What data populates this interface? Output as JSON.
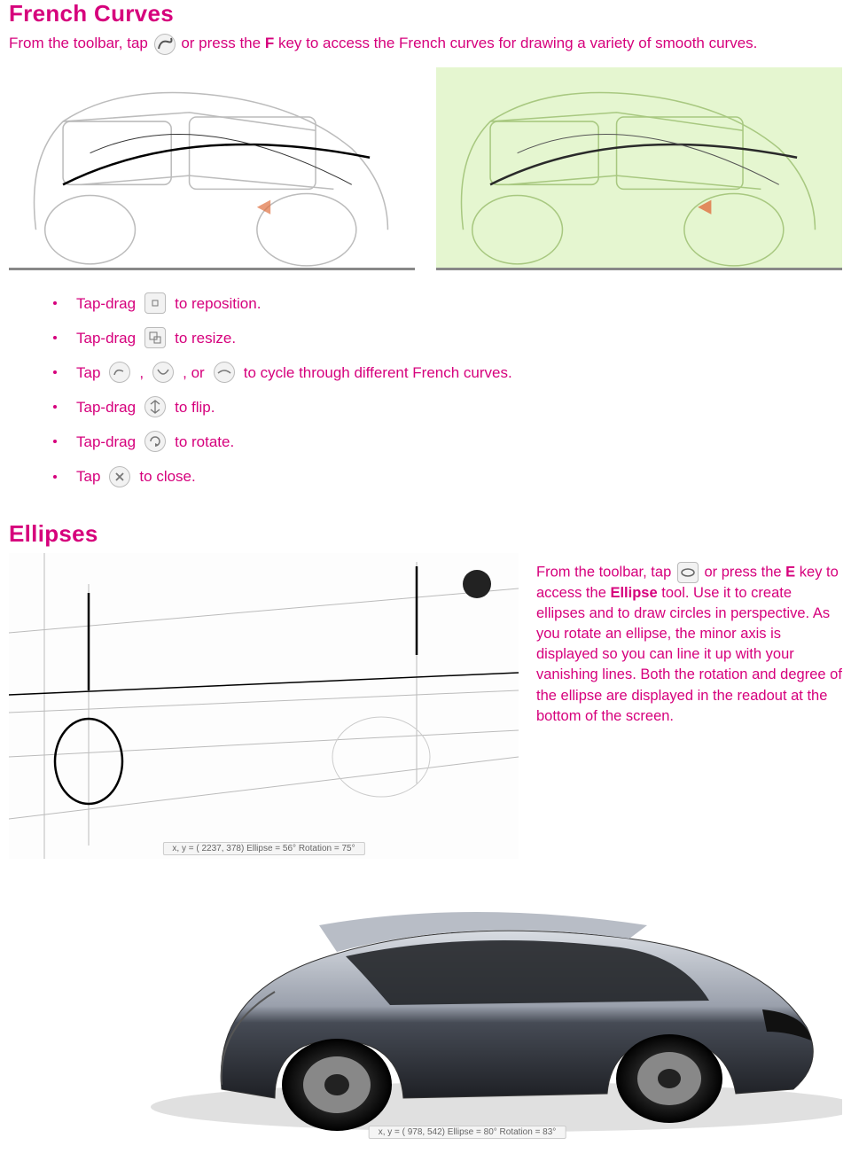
{
  "section1": {
    "heading": "French Curves",
    "intro_pre": "From the toolbar, tap ",
    "intro_mid": " or press the ",
    "intro_key": "F",
    "intro_post": " key to access the French curves for drawing a variety of smooth curves.",
    "bullets": [
      {
        "pre": "Tap-drag ",
        "post": " to reposition."
      },
      {
        "pre": "Tap-drag ",
        "post": " to resize."
      },
      {
        "pre": "Tap ",
        "mid1": ", ",
        "mid2": ", or ",
        "post": " to cycle through different French curves."
      },
      {
        "pre": "Tap-drag ",
        "post": " to flip."
      },
      {
        "pre": "Tap-drag ",
        "post": " to rotate."
      },
      {
        "pre": "Tap ",
        "post": " to close."
      }
    ]
  },
  "section2": {
    "heading": "Ellipses",
    "para_pre": "From the toolbar, tap ",
    "para_mid": " or press the ",
    "para_key": "E",
    "para_mid2": " key to access the ",
    "para_tool": "Ellipse",
    "para_post": " tool. Use it to create ellipses and to draw circles in perspective. As you rotate an ellipse, the minor axis is displayed so you can line it up with your vanishing lines. Both the rotation and degree of the ellipse are displayed in the readout at the bottom of the screen.",
    "readout1": "x, y = ( 2237,  378) Ellipse =  56° Rotation =  75°",
    "readout2": "x, y = (  978,  542) Ellipse =  80° Rotation =  83°"
  }
}
